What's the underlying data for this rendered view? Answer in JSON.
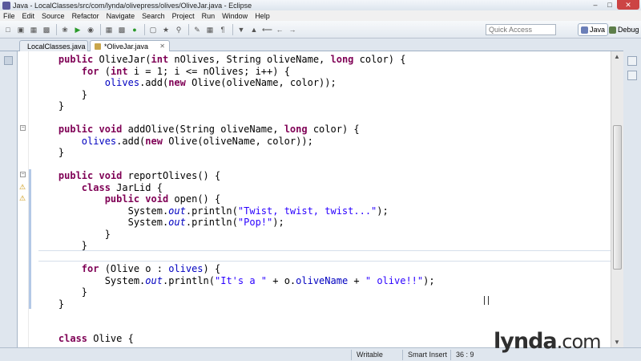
{
  "window": {
    "title": "Java - LocalClasses/src/com/lynda/olivepress/olives/OliveJar.java - Eclipse"
  },
  "menu": [
    "File",
    "Edit",
    "Source",
    "Refactor",
    "Navigate",
    "Search",
    "Project",
    "Run",
    "Window",
    "Help"
  ],
  "quick_access": {
    "placeholder": "Quick Access"
  },
  "perspectives": {
    "java": "Java",
    "debug": "Debug"
  },
  "tabs": [
    {
      "label": "LocalClasses.java",
      "active": false
    },
    {
      "label": "*OliveJar.java",
      "active": true
    }
  ],
  "status": {
    "mode": "Writable",
    "insert": "Smart Insert",
    "position": "36 : 9"
  },
  "watermark": {
    "text": "lynda",
    "suffix": ".com"
  },
  "colors": {
    "keyword": "#7f0055",
    "field": "#0000c0",
    "string": "#2a00ff"
  }
}
